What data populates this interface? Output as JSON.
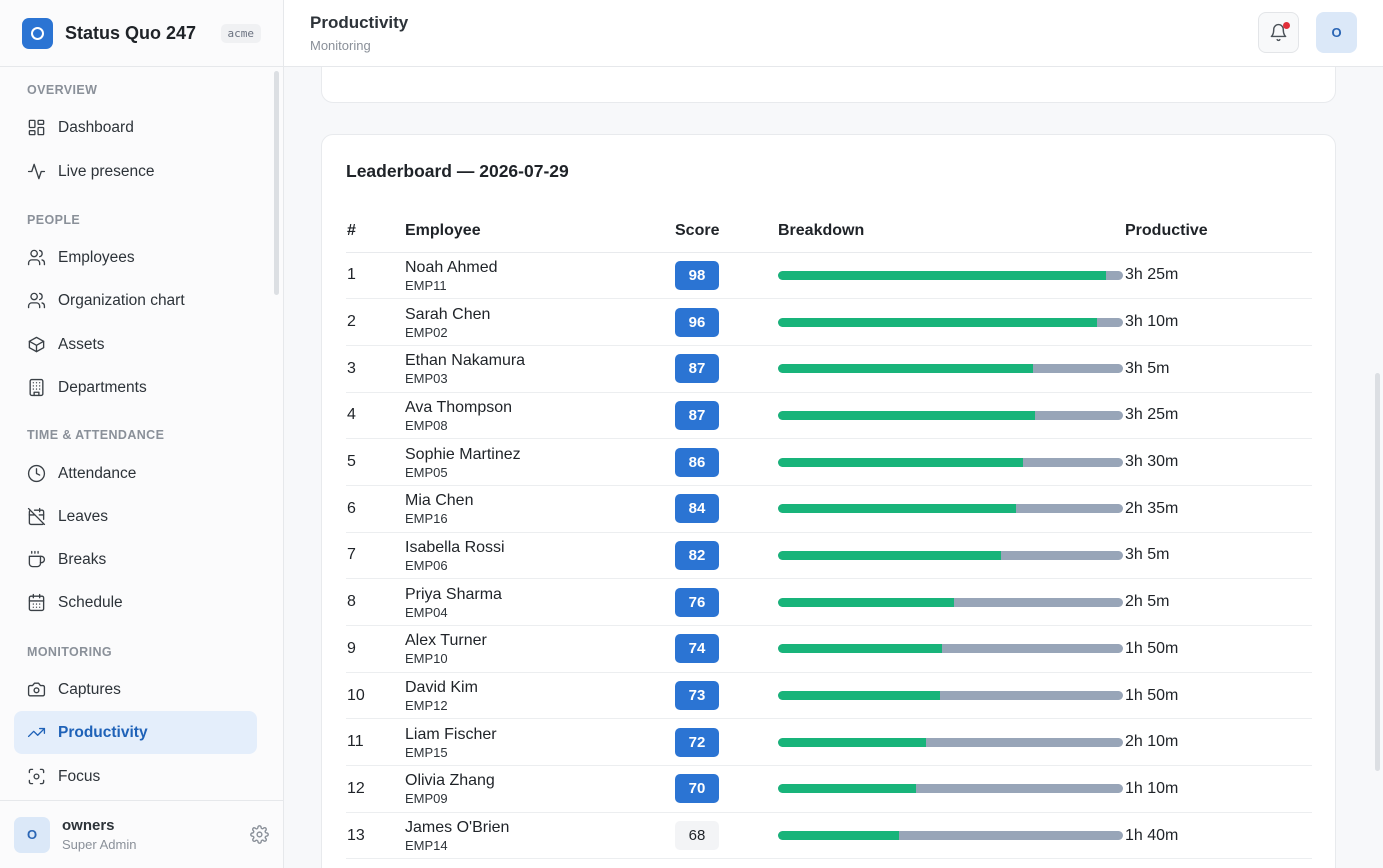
{
  "app": {
    "name": "Status Quo 247",
    "tenant": "acme"
  },
  "sidebar": {
    "sections": [
      {
        "title": "OVERVIEW",
        "items": [
          {
            "label": "Dashboard",
            "icon": "dashboard-icon"
          },
          {
            "label": "Live presence",
            "icon": "activity-icon"
          }
        ]
      },
      {
        "title": "PEOPLE",
        "items": [
          {
            "label": "Employees",
            "icon": "users-icon"
          },
          {
            "label": "Organization chart",
            "icon": "users-icon"
          },
          {
            "label": "Assets",
            "icon": "box-icon"
          },
          {
            "label": "Departments",
            "icon": "building-icon"
          }
        ]
      },
      {
        "title": "TIME & ATTENDANCE",
        "items": [
          {
            "label": "Attendance",
            "icon": "clock-icon"
          },
          {
            "label": "Leaves",
            "icon": "calendar-off-icon"
          },
          {
            "label": "Breaks",
            "icon": "coffee-icon"
          },
          {
            "label": "Schedule",
            "icon": "calendar-icon"
          }
        ]
      },
      {
        "title": "MONITORING",
        "items": [
          {
            "label": "Captures",
            "icon": "camera-icon"
          },
          {
            "label": "Productivity",
            "icon": "trending-up-icon",
            "active": true
          },
          {
            "label": "Focus",
            "icon": "focus-icon"
          }
        ]
      }
    ],
    "user": {
      "initial": "O",
      "name": "owners",
      "role": "Super Admin"
    }
  },
  "header": {
    "title": "Productivity",
    "subtitle": "Monitoring",
    "avatar_initial": "O"
  },
  "leaderboard": {
    "title": "Leaderboard — 2026-07-29",
    "columns": [
      "#",
      "Employee",
      "Score",
      "Breakdown",
      "Productive"
    ],
    "rows": [
      {
        "rank": "1",
        "name": "Noah Ahmed",
        "id": "EMP11",
        "score": "98",
        "productive_pct": 95,
        "productive": "3h 25m"
      },
      {
        "rank": "2",
        "name": "Sarah Chen",
        "id": "EMP02",
        "score": "96",
        "productive_pct": 92.5,
        "productive": "3h 10m"
      },
      {
        "rank": "3",
        "name": "Ethan Nakamura",
        "id": "EMP03",
        "score": "87",
        "productive_pct": 74,
        "productive": "3h 5m"
      },
      {
        "rank": "4",
        "name": "Ava Thompson",
        "id": "EMP08",
        "score": "87",
        "productive_pct": 74.5,
        "productive": "3h 25m"
      },
      {
        "rank": "5",
        "name": "Sophie Martinez",
        "id": "EMP05",
        "score": "86",
        "productive_pct": 71,
        "productive": "3h 30m"
      },
      {
        "rank": "6",
        "name": "Mia Chen",
        "id": "EMP16",
        "score": "84",
        "productive_pct": 69,
        "productive": "2h 35m"
      },
      {
        "rank": "7",
        "name": "Isabella Rossi",
        "id": "EMP06",
        "score": "82",
        "productive_pct": 64.5,
        "productive": "3h 5m"
      },
      {
        "rank": "8",
        "name": "Priya Sharma",
        "id": "EMP04",
        "score": "76",
        "productive_pct": 51,
        "productive": "2h 5m"
      },
      {
        "rank": "9",
        "name": "Alex Turner",
        "id": "EMP10",
        "score": "74",
        "productive_pct": 47.5,
        "productive": "1h 50m"
      },
      {
        "rank": "10",
        "name": "David Kim",
        "id": "EMP12",
        "score": "73",
        "productive_pct": 47,
        "productive": "1h 50m"
      },
      {
        "rank": "11",
        "name": "Liam Fischer",
        "id": "EMP15",
        "score": "72",
        "productive_pct": 43,
        "productive": "2h 10m"
      },
      {
        "rank": "12",
        "name": "Olivia Zhang",
        "id": "EMP09",
        "score": "70",
        "productive_pct": 40,
        "productive": "1h 10m"
      },
      {
        "rank": "13",
        "name": "James O'Brien",
        "id": "EMP14",
        "score": "68",
        "productive_pct": 35,
        "productive": "1h 40m",
        "low": true
      }
    ]
  },
  "colors": {
    "accent": "#2b74d3",
    "productive": "#18b47a",
    "other": "#98a5b8",
    "notification": "#e0303a"
  }
}
